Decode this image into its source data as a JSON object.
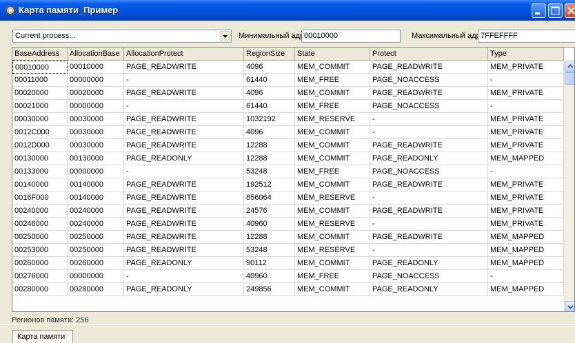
{
  "window": {
    "title": "Карта памяти_Пример"
  },
  "toolbar": {
    "process_value": "Current process...",
    "min_label": "Минимальный адрес",
    "min_value": "00010000",
    "max_label": "Максимальный адрес",
    "max_value": "7FFEFFFF"
  },
  "table": {
    "columns": [
      "BaseAddress",
      "AllocationBase",
      "AllocationProtect",
      "RegionSize",
      "State",
      "Protect",
      "Type"
    ],
    "rows": [
      [
        "00010000",
        "00010000",
        "PAGE_READWRITE",
        "4096",
        "MEM_COMMIT",
        "PAGE_READWRITE",
        "MEM_PRIVATE"
      ],
      [
        "00011000",
        "00000000",
        "-",
        "61440",
        "MEM_FREE",
        "PAGE_NOACCESS",
        "-"
      ],
      [
        "00020000",
        "00020000",
        "PAGE_READWRITE",
        "4096",
        "MEM_COMMIT",
        "PAGE_READWRITE",
        "MEM_PRIVATE"
      ],
      [
        "00021000",
        "00000000",
        "-",
        "61440",
        "MEM_FREE",
        "PAGE_NOACCESS",
        "-"
      ],
      [
        "00030000",
        "00030000",
        "PAGE_READWRITE",
        "1032192",
        "MEM_RESERVE",
        "-",
        "MEM_PRIVATE"
      ],
      [
        "0012C000",
        "00030000",
        "PAGE_READWRITE",
        "4096",
        "MEM_COMMIT",
        "-",
        "MEM_PRIVATE"
      ],
      [
        "0012D000",
        "00030000",
        "PAGE_READWRITE",
        "12288",
        "MEM_COMMIT",
        "PAGE_READWRITE",
        "MEM_PRIVATE"
      ],
      [
        "00130000",
        "00130000",
        "PAGE_READONLY",
        "12288",
        "MEM_COMMIT",
        "PAGE_READONLY",
        "MEM_MAPPED"
      ],
      [
        "00133000",
        "00000000",
        "-",
        "53248",
        "MEM_FREE",
        "PAGE_NOACCESS",
        "-"
      ],
      [
        "00140000",
        "00140000",
        "PAGE_READWRITE",
        "192512",
        "MEM_COMMIT",
        "PAGE_READWRITE",
        "MEM_PRIVATE"
      ],
      [
        "0016F000",
        "00140000",
        "PAGE_READWRITE",
        "856064",
        "MEM_RESERVE",
        "-",
        "MEM_PRIVATE"
      ],
      [
        "00240000",
        "00240000",
        "PAGE_READWRITE",
        "24576",
        "MEM_COMMIT",
        "PAGE_READWRITE",
        "MEM_PRIVATE"
      ],
      [
        "00246000",
        "00240000",
        "PAGE_READWRITE",
        "40960",
        "MEM_RESERVE",
        "-",
        "MEM_PRIVATE"
      ],
      [
        "00250000",
        "00250000",
        "PAGE_READWRITE",
        "12288",
        "MEM_COMMIT",
        "PAGE_READWRITE",
        "MEM_MAPPED"
      ],
      [
        "00253000",
        "00250000",
        "PAGE_READWRITE",
        "53248",
        "MEM_RESERVE",
        "-",
        "MEM_MAPPED"
      ],
      [
        "00260000",
        "00260000",
        "PAGE_READONLY",
        "90112",
        "MEM_COMMIT",
        "PAGE_READONLY",
        "MEM_MAPPED"
      ],
      [
        "00276000",
        "00000000",
        "-",
        "40960",
        "MEM_FREE",
        "PAGE_NOACCESS",
        "-"
      ],
      [
        "00280000",
        "00280000",
        "PAGE_READONLY",
        "249856",
        "MEM_COMMIT",
        "PAGE_READONLY",
        "MEM_MAPPED"
      ]
    ]
  },
  "status": {
    "text": "Регионов памяти: 256"
  },
  "tabs": [
    {
      "label": "Карта памяти"
    }
  ]
}
